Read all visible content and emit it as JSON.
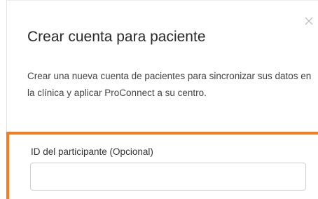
{
  "modal": {
    "title": "Crear cuenta para paciente",
    "description": "Crear una nueva cuenta de pacientes para sincronizar sus datos en la clínica y aplicar ProConnect a su centro.",
    "close_icon": "close-icon"
  },
  "form": {
    "participant_id": {
      "label": "ID del participante (Opcional)",
      "value": "",
      "placeholder": ""
    }
  },
  "colors": {
    "accent": "#f47c20",
    "title_text": "#2a2a2a",
    "body_text": "#444444",
    "input_border": "#cfcfcf"
  }
}
